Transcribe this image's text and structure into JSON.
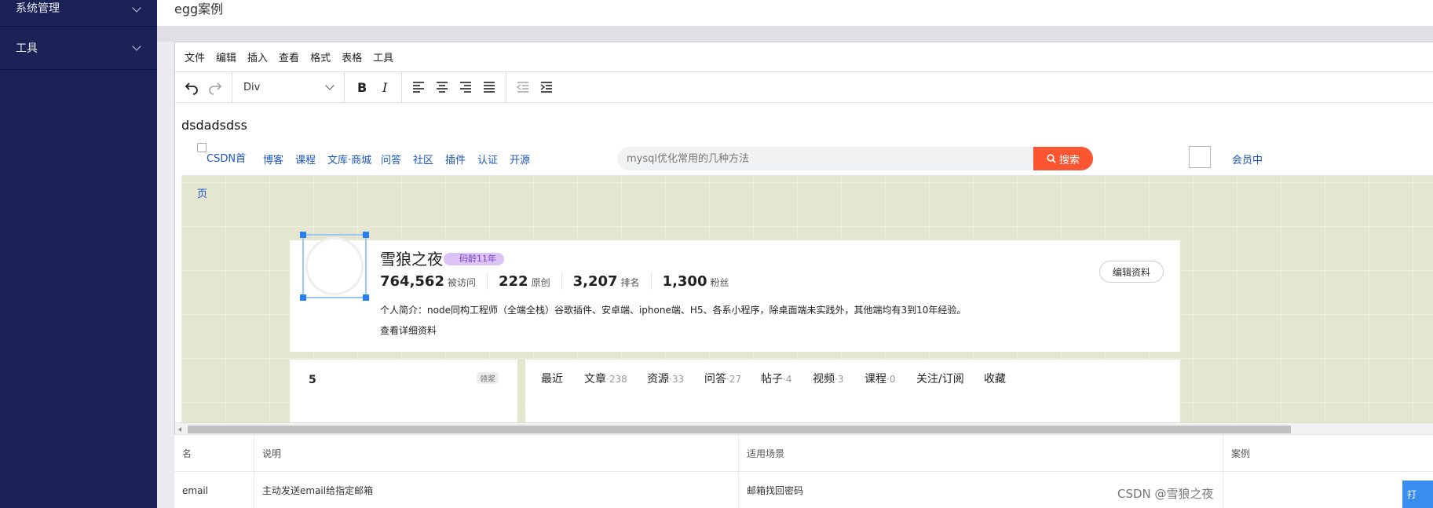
{
  "sidebar": {
    "items": [
      {
        "label": "系统管理"
      },
      {
        "label": "工具"
      }
    ]
  },
  "header": {
    "title": "egg案例"
  },
  "editor": {
    "menu": [
      "文件",
      "编辑",
      "插入",
      "查看",
      "格式",
      "表格",
      "工具"
    ],
    "block_format": "Div",
    "content_text": "dsdadsdss"
  },
  "embedded": {
    "logo_alt": "CSDN首",
    "logo_alt_wrap": "页",
    "nav": [
      "博客",
      "课程",
      "文库·商城",
      "问答",
      "社区",
      "插件",
      "认证",
      "开源"
    ],
    "search_placeholder": "mysql优化常用的几种方法",
    "search_button": "搜索",
    "vip_link": "会员中",
    "profile": {
      "name": "雪狼之夜",
      "badge": "码龄11年",
      "stats": [
        {
          "value": "764,562",
          "label": "被访问"
        },
        {
          "value": "222",
          "label": "原创"
        },
        {
          "value": "3,207",
          "label": "排名"
        },
        {
          "value": "1,300",
          "label": "粉丝"
        }
      ],
      "bio": "个人简介：node同构工程师（全端全栈）谷歌插件、安卓端、iphone端、H5、各系小程序，除桌面端未实践外，其他端均有3到10年经验。",
      "more_link": "查看详细资料",
      "edit_button": "编辑资料"
    },
    "lower_left": {
      "num": "5",
      "tag": "领浆"
    },
    "tabs": [
      {
        "label": "最近",
        "count": ""
      },
      {
        "label": "文章",
        "count": "·238"
      },
      {
        "label": "资源",
        "count": "·33"
      },
      {
        "label": "问答",
        "count": "·27"
      },
      {
        "label": "帖子",
        "count": "·4"
      },
      {
        "label": "视频",
        "count": "·3"
      },
      {
        "label": "课程",
        "count": "·0"
      },
      {
        "label": "关注/订阅",
        "count": ""
      },
      {
        "label": "收藏",
        "count": ""
      }
    ]
  },
  "table": {
    "headers": [
      "名",
      "说明",
      "适用场景",
      "案例"
    ],
    "rows": [
      [
        "email",
        "主动发送email给指定邮箱",
        "邮箱找回密码",
        ""
      ]
    ]
  },
  "watermark": "CSDN @雪狼之夜",
  "float_button": "打"
}
